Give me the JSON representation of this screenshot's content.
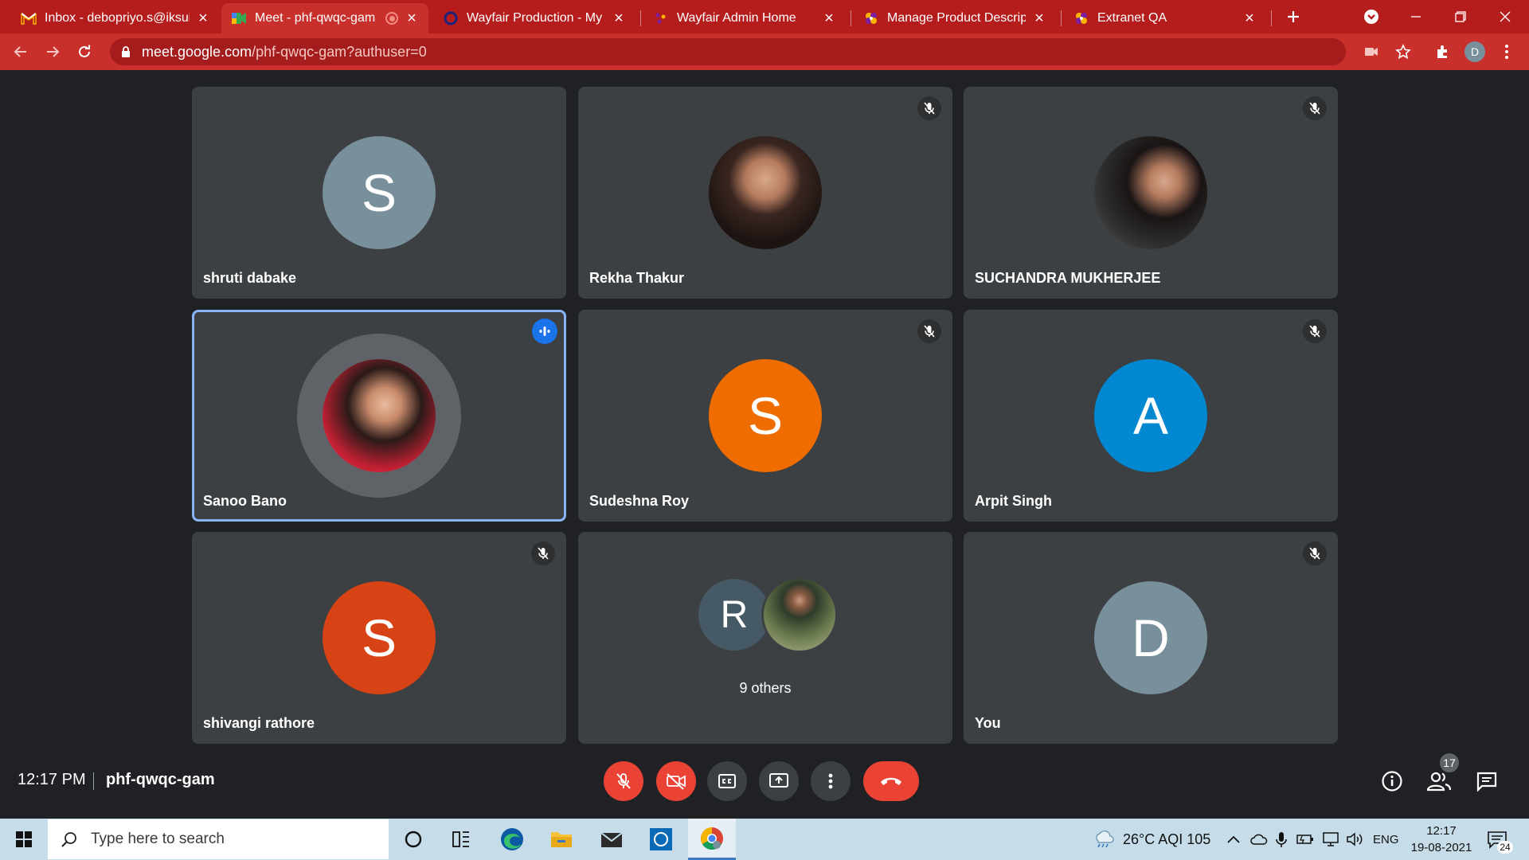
{
  "browser": {
    "tabs": [
      {
        "title": "Inbox - debopriyo.s@iksula.com",
        "icon": "gmail-icon"
      },
      {
        "title": "Meet - phf-qwqc-gam",
        "icon": "meet-icon",
        "active": true,
        "recording": true
      },
      {
        "title": "Wayfair Production - My Apps",
        "icon": "okta-icon"
      },
      {
        "title": "Wayfair Admin Home",
        "icon": "wayfair-icon"
      },
      {
        "title": "Manage Product Description",
        "icon": "wayfair-pinwheel-icon"
      },
      {
        "title": "Extranet QA",
        "icon": "wayfair-pinwheel-icon"
      }
    ],
    "url_host": "meet.google.com",
    "url_path": "/phf-qwqc-gam?authuser=0",
    "profile_initial": "D"
  },
  "meet": {
    "participants": [
      {
        "name": "shruti dabake",
        "initial": "S",
        "avatar_color": "#78909c",
        "muted": false,
        "speaking": false
      },
      {
        "name": "Rekha Thakur",
        "initial": "",
        "avatar_color": "",
        "photo": true,
        "muted": true,
        "speaking": false
      },
      {
        "name": "SUCHANDRA MUKHERJEE",
        "initial": "",
        "avatar_color": "",
        "photo": true,
        "muted": true,
        "speaking": false
      },
      {
        "name": "Sanoo Bano",
        "initial": "",
        "avatar_color": "",
        "photo": true,
        "muted": false,
        "speaking": true
      },
      {
        "name": "Sudeshna Roy",
        "initial": "S",
        "avatar_color": "#ef6c00",
        "muted": true,
        "speaking": false
      },
      {
        "name": "Arpit Singh",
        "initial": "A",
        "avatar_color": "#0288d1",
        "muted": true,
        "speaking": false
      },
      {
        "name": "shivangi rathore",
        "initial": "S",
        "avatar_color": "#d84315",
        "muted": true,
        "speaking": false
      },
      {
        "name": "You",
        "initial": "D",
        "avatar_color": "#78909c",
        "muted": true,
        "speaking": false
      }
    ],
    "others": {
      "label": "9 others",
      "initial": "R",
      "avatar_color": "#455a64"
    },
    "time": "12:17 PM",
    "meeting_code": "phf-qwqc-gam",
    "people_count": "17",
    "accent_red": "#ea4335",
    "accent_blue": "#8ab4f8"
  },
  "taskbar": {
    "search_placeholder": "Type here to search",
    "weather": "26°C  AQI 105",
    "language": "ENG",
    "time": "12:17",
    "date": "19-08-2021",
    "notifications": "24"
  }
}
